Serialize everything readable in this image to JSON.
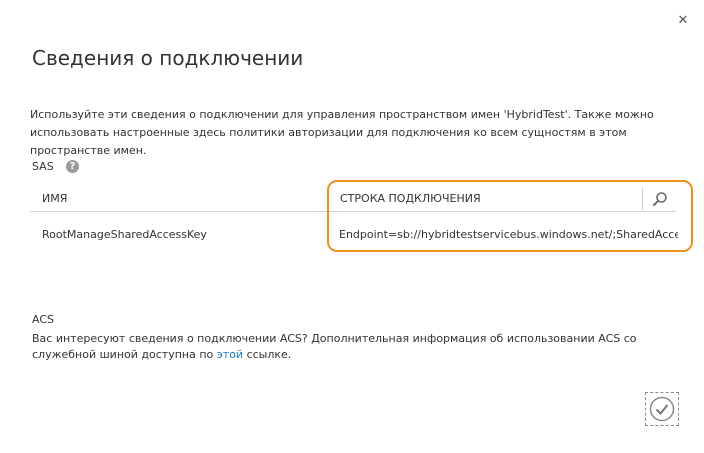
{
  "dialog": {
    "title": "Сведения о подключении",
    "close_symbol": "✕",
    "intro": "Используйте эти сведения о подключении для управления пространством имен 'HybridTest'. Также можно использовать настроенные здесь политики авторизации для подключения ко всем сущностям в этом пространстве имен."
  },
  "sas": {
    "label": "SAS",
    "help_symbol": "?",
    "columns": {
      "name": "ИМЯ",
      "connection_string": "СТРОКА ПОДКЛЮЧЕНИЯ"
    },
    "rows": [
      {
        "name": "RootManageSharedAccessKey",
        "connection_string": "Endpoint=sb://hybridtestservicebus.windows.net/;SharedAccess"
      }
    ]
  },
  "acs": {
    "label": "ACS",
    "text_before": "Вас интересуют сведения о подключении ACS? Дополнительная информация об использовании ACS со служебной шиной доступна по ",
    "link": "этой",
    "text_after": " ссылке."
  },
  "colors": {
    "highlight": "#f0901e",
    "link": "#1a7cc7"
  },
  "icons": {
    "close": "close-icon",
    "help": "help-icon",
    "search": "search-icon",
    "confirm": "checkmark-icon"
  }
}
